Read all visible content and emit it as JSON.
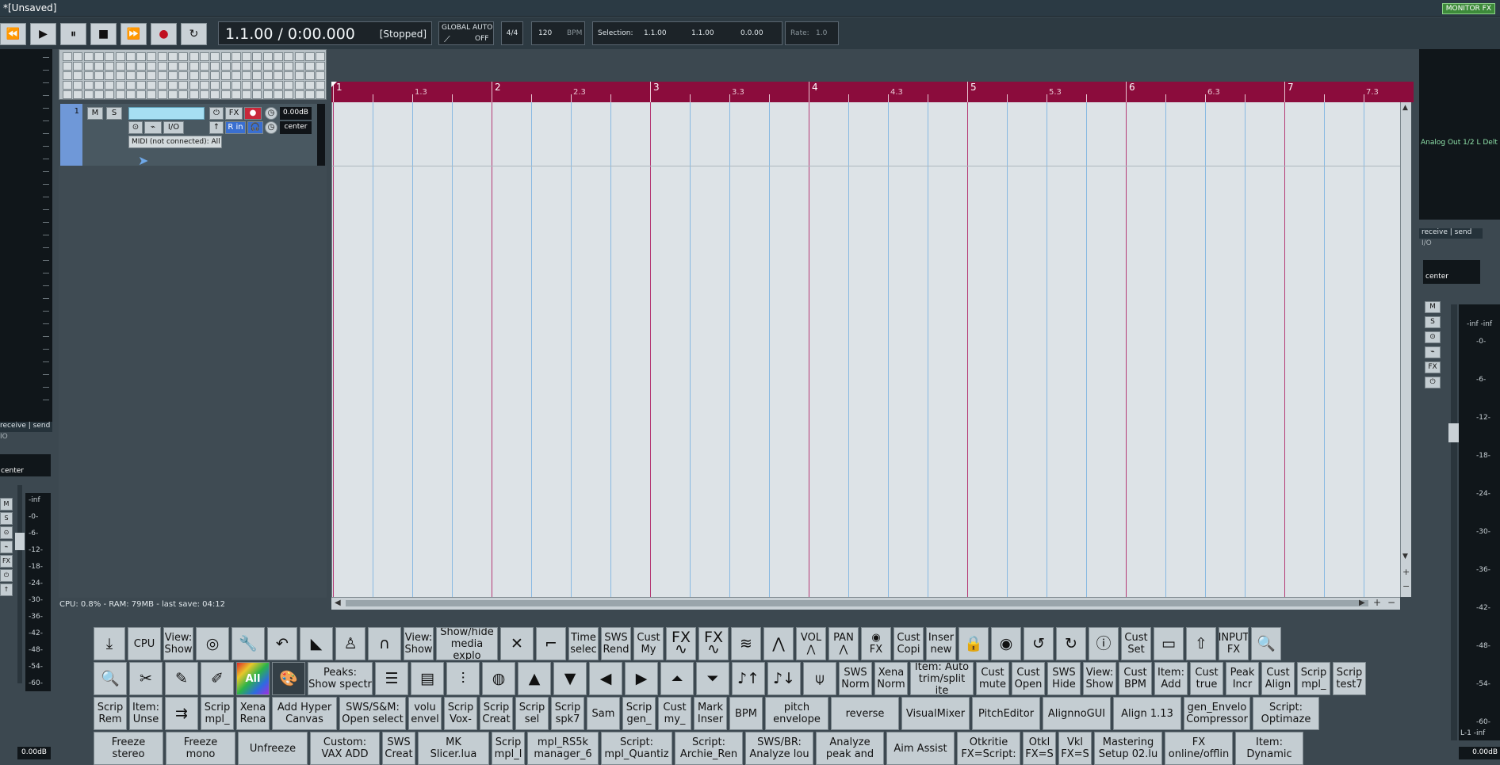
{
  "window": {
    "title": "*[Unsaved]",
    "monitor_fx": "MONITOR FX"
  },
  "transport": {
    "buttons": [
      {
        "name": "rewind-button",
        "glyph": "⏪"
      },
      {
        "name": "play-button",
        "glyph": "▶"
      },
      {
        "name": "pause-button",
        "glyph": "⏸"
      },
      {
        "name": "stop-button",
        "glyph": "■"
      },
      {
        "name": "fast-forward-button",
        "glyph": "⏩"
      },
      {
        "name": "record-button",
        "glyph": "●"
      },
      {
        "name": "repeat-button",
        "glyph": "↻"
      }
    ],
    "time": "1.1.00 / 0:00.000",
    "state": "[Stopped]",
    "global_auto_label": "GLOBAL AUTO",
    "global_auto_value": "OFF",
    "time_sig": "4/4",
    "bpm": "120",
    "bpm_label": "BPM",
    "selection_label": "Selection:",
    "selection_start": "1.1.00",
    "selection_end": "1.1.00",
    "selection_length": "0.0.00",
    "rate_label": "Rate:",
    "rate": "1.0"
  },
  "track": {
    "number": "1",
    "mute": "M",
    "solo": "S",
    "fx": "FX",
    "io": "I/O",
    "volume": "0.00dB",
    "pan": "center",
    "input": "MIDI (not connected): All c",
    "rin": "R in"
  },
  "status": "CPU: 0.8% - RAM: 79MB - last save: 04:12",
  "ruler": {
    "bars": [
      "1",
      "2",
      "3",
      "4",
      "5",
      "6",
      "7"
    ],
    "beats": [
      "1.3",
      "2.3",
      "3.3",
      "4.3",
      "5.3",
      "6.3",
      "7.3"
    ]
  },
  "left_strip": {
    "receive_send": "receive | send",
    "io": "IO",
    "pan": "center",
    "buttons": [
      "M",
      "S",
      "⊙",
      "⌁",
      "FX",
      "⏻",
      "↑"
    ],
    "meter_labels": [
      "-inf",
      "-0-",
      "-6-",
      "-12-",
      "-18-",
      "-24-",
      "-30-",
      "-36-",
      "-42-",
      "-48-",
      "-54-",
      "-60-"
    ],
    "volume": "0.00dB"
  },
  "master": {
    "output": "Analog Out 1/2 L Delt",
    "receive_send": "receive | send",
    "io": "I/O",
    "pan": "center",
    "buttons": [
      "M",
      "S",
      "⊙",
      "⌁",
      "FX",
      "⏻"
    ],
    "meter_header": "-inf   -inf",
    "meter_labels": [
      "-0-",
      "-6-",
      "-12-",
      "-18-",
      "-24-",
      "-30-",
      "-36-",
      "-42-",
      "-48-",
      "-54-",
      "-60-"
    ],
    "channels": "L-1   -inf",
    "volume": "0.00dB"
  },
  "toolbar_rows": [
    [
      {
        "id": "import",
        "label": "⤓",
        "icon": true
      },
      {
        "id": "cpu",
        "label": "CPU"
      },
      {
        "id": "view-show-1",
        "label": "View:\nShow"
      },
      {
        "id": "disc",
        "label": "◎",
        "icon": true
      },
      {
        "id": "wrench",
        "label": "🔧",
        "icon": true
      },
      {
        "id": "undo",
        "label": "↶",
        "icon": true
      },
      {
        "id": "zoom-cursor",
        "label": "◣",
        "icon": true
      },
      {
        "id": "metronome",
        "label": "♙",
        "icon": true
      },
      {
        "id": "snap",
        "label": "∩",
        "icon": true
      },
      {
        "id": "view-show-2",
        "label": "View:\nShow"
      },
      {
        "id": "media-explorer",
        "label": "Show/hide\nmedia explo"
      },
      {
        "id": "crossfade",
        "label": "✕",
        "icon": true
      },
      {
        "id": "bracket",
        "label": "⌐",
        "icon": true
      },
      {
        "id": "time-select",
        "label": "Time\nselec"
      },
      {
        "id": "sws-rend",
        "label": "SWS\nRend"
      },
      {
        "id": "cust-my",
        "label": "Cust\nMy"
      },
      {
        "id": "fx-wave-1",
        "label": "FX\n∿",
        "icon": true
      },
      {
        "id": "fx-wave-2",
        "label": "FX\n∿",
        "icon": true
      },
      {
        "id": "env-wave",
        "label": "≋",
        "icon": true
      },
      {
        "id": "env-points",
        "label": "⋀",
        "icon": true
      },
      {
        "id": "vol-env",
        "label": "VOL\n⋀"
      },
      {
        "id": "pan-env",
        "label": "PAN\n⋀"
      },
      {
        "id": "eye-fx",
        "label": "◉\nFX"
      },
      {
        "id": "cust-copi",
        "label": "Cust\nCopi"
      },
      {
        "id": "insert-new",
        "label": "Inser\nnew"
      },
      {
        "id": "lock",
        "label": "🔒",
        "icon": true
      },
      {
        "id": "eye-mixer",
        "label": "◉",
        "icon": true
      },
      {
        "id": "loop-1",
        "label": "↺",
        "icon": true
      },
      {
        "id": "loop-2",
        "label": "↻",
        "icon": true
      },
      {
        "id": "info",
        "label": "ⓘ",
        "icon": true
      },
      {
        "id": "cust-set",
        "label": "Cust\nSet"
      },
      {
        "id": "routing",
        "label": "▭",
        "icon": true
      },
      {
        "id": "upload",
        "label": "⇧",
        "icon": true
      },
      {
        "id": "input-fx",
        "label": "INPUT\nFX"
      },
      {
        "id": "zoom-wave",
        "label": "🔍",
        "icon": true
      }
    ],
    [
      {
        "id": "zoom-wave-2",
        "label": "🔍",
        "icon": true
      },
      {
        "id": "scissors",
        "label": "✂",
        "icon": true
      },
      {
        "id": "pencil",
        "label": "✎",
        "icon": true
      },
      {
        "id": "pencil-2",
        "label": "✐",
        "icon": true
      },
      {
        "id": "all",
        "label": "All",
        "all": true
      },
      {
        "id": "palette",
        "label": "🎨",
        "dark": true,
        "icon": true
      },
      {
        "id": "peaks",
        "label": "Peaks:\nShow spectr"
      },
      {
        "id": "list-1",
        "label": "☰",
        "icon": true
      },
      {
        "id": "list-2",
        "label": "▤",
        "icon": true
      },
      {
        "id": "mixer",
        "label": "⫶",
        "icon": true
      },
      {
        "id": "barrel",
        "label": "◍",
        "icon": true
      },
      {
        "id": "up",
        "label": "▲",
        "icon": true
      },
      {
        "id": "down",
        "label": "▼",
        "icon": true
      },
      {
        "id": "left",
        "label": "◀",
        "icon": true
      },
      {
        "id": "right",
        "label": "▶",
        "icon": true
      },
      {
        "id": "up-bar",
        "label": "⏶",
        "icon": true
      },
      {
        "id": "down-bar",
        "label": "⏷",
        "icon": true
      },
      {
        "id": "note-up",
        "label": "♪↑",
        "icon": true
      },
      {
        "id": "note-down",
        "label": "♪↓",
        "icon": true
      },
      {
        "id": "marker-pin",
        "label": "⍦",
        "icon": true
      },
      {
        "id": "sws-norm",
        "label": "SWS\nNorm"
      },
      {
        "id": "xena-norm",
        "label": "Xena\nNorm"
      },
      {
        "id": "item-auto-trim",
        "label": "Item: Auto\ntrim/split ite"
      },
      {
        "id": "cust-mute",
        "label": "Cust\nmute"
      },
      {
        "id": "cust-open",
        "label": "Cust\nOpen"
      },
      {
        "id": "sws-hide",
        "label": "SWS\nHide"
      },
      {
        "id": "view-show-3",
        "label": "View:\nShow"
      },
      {
        "id": "cust-bpm",
        "label": "Cust\nBPM"
      },
      {
        "id": "item-add",
        "label": "Item:\nAdd"
      },
      {
        "id": "cust-true",
        "label": "Cust\ntrue"
      },
      {
        "id": "peak-incr",
        "label": "Peak\nIncr"
      },
      {
        "id": "cust-align",
        "label": "Cust\nAlign"
      },
      {
        "id": "scrip-mpl",
        "label": "Scrip\nmpl_"
      },
      {
        "id": "scrip-test7",
        "label": "Scrip\ntest7"
      }
    ],
    [
      {
        "id": "scrip-rem",
        "label": "Scrip\nRem"
      },
      {
        "id": "item-unse",
        "label": "Item:\nUnse"
      },
      {
        "id": "arrow-box",
        "label": "⇉",
        "icon": true
      },
      {
        "id": "scrip-mpl-2",
        "label": "Scrip\nmpl_"
      },
      {
        "id": "xena-rena",
        "label": "Xena\nRena"
      },
      {
        "id": "add-hyper-canvas",
        "label": "Add Hyper\nCanvas"
      },
      {
        "id": "sws-s-m-open-select",
        "label": "SWS/S&M:\nOpen select"
      },
      {
        "id": "volu-envel",
        "label": "volu\nenvel"
      },
      {
        "id": "scrip-vox",
        "label": "Scrip\nVox-"
      },
      {
        "id": "scrip-creat",
        "label": "Scrip\nCreat"
      },
      {
        "id": "scrip-sel",
        "label": "Scrip\nsel"
      },
      {
        "id": "scrip-spk7",
        "label": "Scrip\nspk7"
      },
      {
        "id": "sam",
        "label": "Sam"
      },
      {
        "id": "scrip-gen",
        "label": "Scrip\ngen_"
      },
      {
        "id": "cust-my-2",
        "label": "Cust\nmy_"
      },
      {
        "id": "mark-inser",
        "label": "Mark\nInser"
      },
      {
        "id": "bpm",
        "label": "BPM"
      },
      {
        "id": "pitch-envelope",
        "label": "pitch\nenvelope"
      },
      {
        "id": "reverse",
        "label": "reverse"
      },
      {
        "id": "visualmixer",
        "label": "VisualMixer"
      },
      {
        "id": "pitcheditor",
        "label": "PitchEditor"
      },
      {
        "id": "alignnogui",
        "label": "AlignnoGUI"
      },
      {
        "id": "align-113",
        "label": "Align 1.13"
      },
      {
        "id": "gen-envelo-compressor",
        "label": "gen_Envelo\nCompressor"
      },
      {
        "id": "script-optimaze",
        "label": "Script:\nOptimaze"
      }
    ],
    [
      {
        "id": "freeze-stereo",
        "label": "Freeze\nstereo"
      },
      {
        "id": "freeze-mono",
        "label": "Freeze\nmono"
      },
      {
        "id": "unfreeze",
        "label": "Unfreeze"
      },
      {
        "id": "custom-vax-add",
        "label": "Custom:\nVAX ADD"
      },
      {
        "id": "sws-creat",
        "label": "SWS\nCreat"
      },
      {
        "id": "mk-slicer",
        "label": "MK\nSlicer.lua"
      },
      {
        "id": "scrip-mpl-3",
        "label": "Scrip\nmpl_l"
      },
      {
        "id": "mpl-rs5k",
        "label": "mpl_RS5k\nmanager_6"
      },
      {
        "id": "script-mpl-quantiz",
        "label": "Script:\nmpl_Quantiz"
      },
      {
        "id": "script-archie",
        "label": "Script:\nArchie_Ren"
      },
      {
        "id": "sws-br-analyze",
        "label": "SWS/BR:\nAnalyze lou"
      },
      {
        "id": "analyze-peak",
        "label": "Analyze\npeak and"
      },
      {
        "id": "aim-assist",
        "label": "Aim Assist"
      },
      {
        "id": "otkritie",
        "label": "Otkritie\nFX=Script:"
      },
      {
        "id": "otkl",
        "label": "Otkl\nFX=S"
      },
      {
        "id": "vkl",
        "label": "Vkl\nFX=S"
      },
      {
        "id": "mastering-setup",
        "label": "Mastering\nSetup 02.lu"
      },
      {
        "id": "fx-online-offline",
        "label": "FX\nonline/offlin"
      },
      {
        "id": "item-dynamic",
        "label": "Item:\nDynamic"
      }
    ]
  ]
}
